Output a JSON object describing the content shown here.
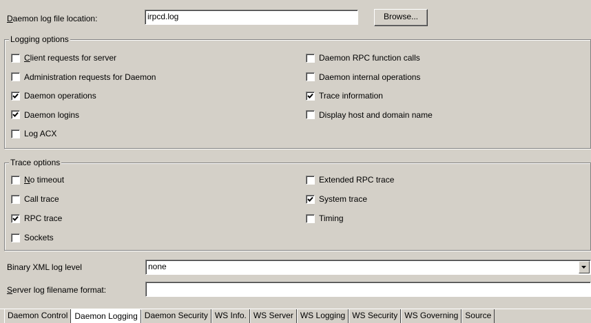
{
  "daemon_log": {
    "label_mnemonic": "D",
    "label_rest": "aemon log file location:",
    "value": "irpcd.log",
    "browse_label": "Browse..."
  },
  "logging_options": {
    "title": "Logging options",
    "left": [
      {
        "mnemonic": "C",
        "rest": "lient requests for server",
        "checked": false
      },
      {
        "mnemonic": "",
        "rest": "Administration requests for Daemon",
        "checked": false
      },
      {
        "mnemonic": "",
        "rest": "Daemon operations",
        "checked": true
      },
      {
        "mnemonic": "",
        "rest": "Daemon logins",
        "checked": true
      },
      {
        "mnemonic": "",
        "rest": "Log ACX",
        "checked": false
      }
    ],
    "right": [
      {
        "mnemonic": "",
        "rest": "Daemon RPC function calls",
        "checked": false
      },
      {
        "mnemonic": "",
        "rest": "Daemon internal operations",
        "checked": false
      },
      {
        "mnemonic": "",
        "rest": "Trace information",
        "checked": true
      },
      {
        "mnemonic": "",
        "rest": "Display host and domain name",
        "checked": false
      }
    ]
  },
  "trace_options": {
    "title": "Trace options",
    "left": [
      {
        "mnemonic": "N",
        "rest": "o timeout",
        "checked": false
      },
      {
        "mnemonic": "",
        "rest": "Call trace",
        "checked": false
      },
      {
        "mnemonic": "",
        "rest": "RPC trace",
        "checked": true
      },
      {
        "mnemonic": "",
        "rest": "Sockets",
        "checked": false
      }
    ],
    "right": [
      {
        "mnemonic": "",
        "rest": "Extended RPC trace",
        "checked": false
      },
      {
        "mnemonic": "",
        "rest": "System trace",
        "checked": true
      },
      {
        "mnemonic": "",
        "rest": "Timing",
        "checked": false
      }
    ]
  },
  "binary_xml": {
    "label": "Binary XML log level",
    "value": "none"
  },
  "server_log": {
    "label_mnemonic": "S",
    "label_rest": "erver log filename format:",
    "value": ""
  },
  "tabs": [
    {
      "label": "Daemon Control",
      "active": false
    },
    {
      "label": "Daemon Logging",
      "active": true
    },
    {
      "label": "Daemon Security",
      "active": false
    },
    {
      "label": "WS Info.",
      "active": false
    },
    {
      "label": "WS Server",
      "active": false
    },
    {
      "label": "WS Logging",
      "active": false
    },
    {
      "label": "WS Security",
      "active": false
    },
    {
      "label": "WS Governing",
      "active": false
    },
    {
      "label": "Source",
      "active": false
    }
  ]
}
